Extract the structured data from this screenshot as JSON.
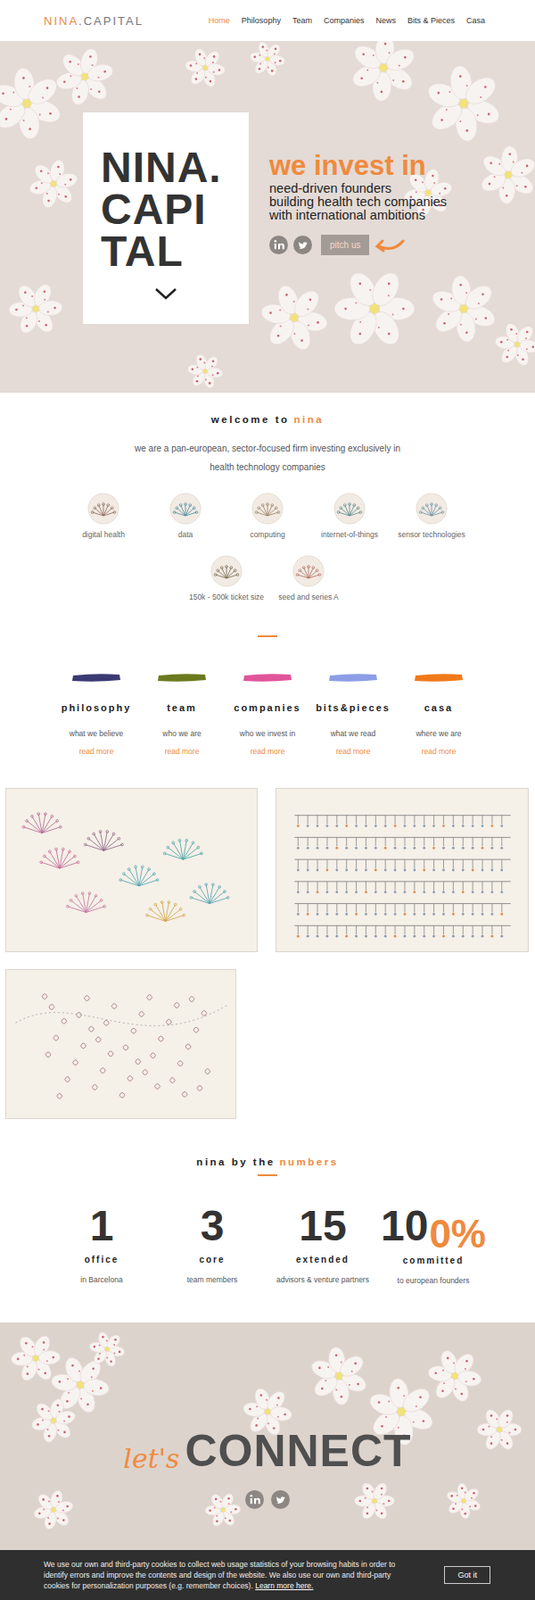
{
  "nav": {
    "logo_a": "NINA",
    "logo_b": ".CAPITAL",
    "items": [
      {
        "label": "Home",
        "selected": true
      },
      {
        "label": "Philosophy",
        "selected": false
      },
      {
        "label": "Team",
        "selected": false
      },
      {
        "label": "Companies",
        "selected": false
      },
      {
        "label": "News",
        "selected": false
      },
      {
        "label": "Bits & Pieces",
        "selected": false
      },
      {
        "label": "Casa",
        "selected": false
      }
    ]
  },
  "hero": {
    "title": [
      "NINA.",
      "CAPI",
      "TAL"
    ],
    "heading": "we invest in",
    "lines": [
      "need-driven founders",
      "building health tech companies",
      "with international ambitions"
    ],
    "button": "pitch us"
  },
  "welcome": {
    "title_a": "welcome to",
    "title_b": "nina",
    "lines": [
      "we are a pan-european, sector-focused firm investing exclusively in",
      "health technology companies"
    ],
    "features": [
      {
        "label": "digital health"
      },
      {
        "label": "data"
      },
      {
        "label": "computing"
      },
      {
        "label": "internet-of-things"
      },
      {
        "label": "sensor technologies"
      },
      {
        "label": "150k - 500k ticket size"
      },
      {
        "label": "seed and series A"
      }
    ]
  },
  "sections": [
    {
      "title": "philosophy",
      "sub": "what we believe",
      "link": "read more",
      "color": "#3b3a72"
    },
    {
      "title": "team",
      "sub": "who we are",
      "link": "read more",
      "color": "#6b7a1e"
    },
    {
      "title": "companies",
      "sub": "who we invest in",
      "link": "read more",
      "color": "#e0559a"
    },
    {
      "title": "bits&pieces",
      "sub": "what we read",
      "link": "read more",
      "color": "#8d9ee6"
    },
    {
      "title": "casa",
      "sub": "where we are",
      "link": "read more",
      "color": "#f07a1a"
    }
  ],
  "numbers": {
    "title_a": "nina by the",
    "title_b": "numbers",
    "items": [
      {
        "value": "1",
        "suffix": "",
        "label": "office",
        "sub": "in Barcelona"
      },
      {
        "value": "3",
        "suffix": "",
        "label": "core",
        "sub": "team members"
      },
      {
        "value": "15",
        "suffix": "",
        "label": "extended",
        "sub": "advisors & venture partners"
      },
      {
        "value": "10",
        "suffix": "0%",
        "label": "committed",
        "sub": "to european founders"
      }
    ]
  },
  "connect": {
    "script": "let's",
    "title": "CONNECT"
  },
  "cookie": {
    "text": "We use our own and third-party cookies to collect web usage statistics of your browsing habits in order to identify errors and improve the contents and design of the website. We also use our own and third-party cookies for personalization purposes (e.g. remember choices).",
    "link": "Learn more here.",
    "button": "Got it"
  }
}
